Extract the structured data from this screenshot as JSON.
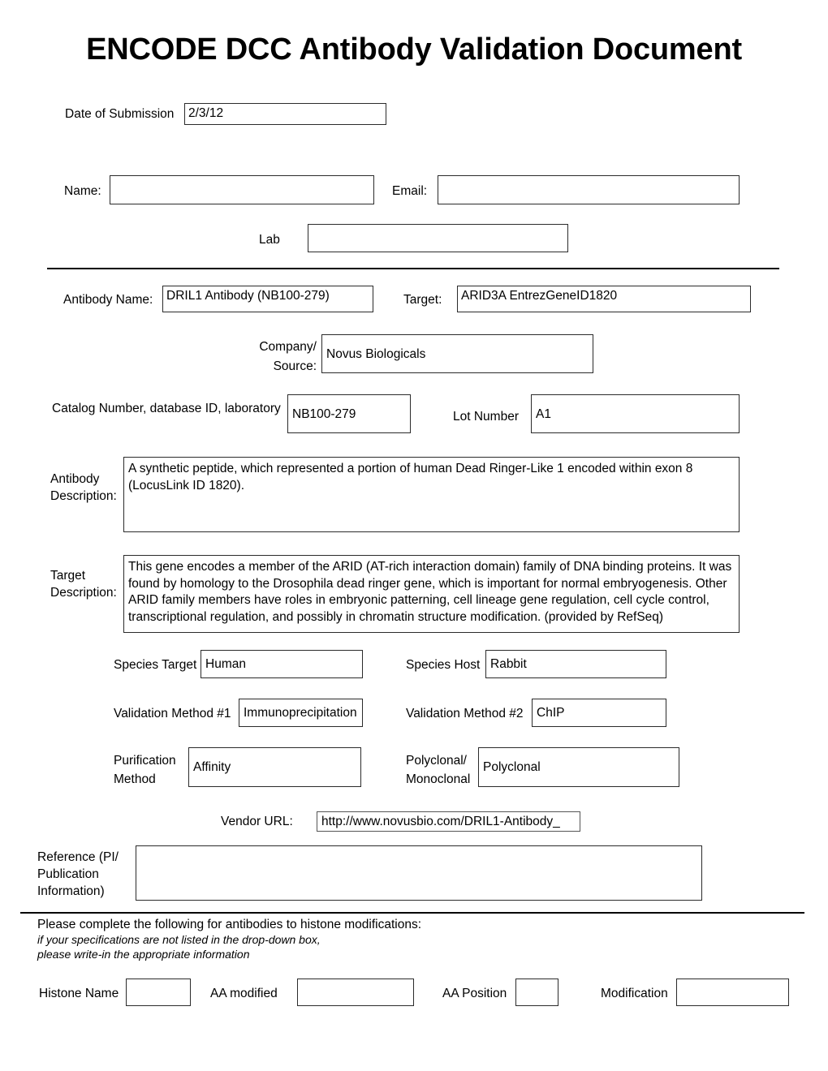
{
  "document": {
    "title": "ENCODE DCC Antibody Validation Document"
  },
  "submission": {
    "date_label": "Date of Submission",
    "date_value": "2/3/12"
  },
  "submitter": {
    "name_label": "Name:",
    "name_value": "",
    "email_label": "Email:",
    "email_value": "",
    "lab_label": "Lab",
    "lab_value": ""
  },
  "antibody": {
    "name_label": "Antibody Name:",
    "name_value": "DRIL1 Antibody (NB100-279)",
    "target_label": "Target:",
    "target_value": "ARID3A EntrezGeneID1820",
    "company_label": "Company/\nSource:",
    "company_label_line1": "Company/",
    "company_label_line2": "Source:",
    "company_value": "Novus Biologicals",
    "catalog_label": "Catalog Number, database ID, laboratory",
    "catalog_value": "NB100-279",
    "lot_label": "Lot Number",
    "lot_value": "A1",
    "description_label_line1": "Antibody",
    "description_label_line2": "Description:",
    "description_value": "A synthetic peptide, which represented a portion of human Dead Ringer-Like 1 encoded within exon 8 (LocusLink ID 1820).",
    "target_description_label_line1": "Target",
    "target_description_label_line2": "Description:",
    "target_description_value": "This gene encodes a member of the ARID (AT-rich interaction domain) family of DNA binding proteins. It was found by homology to the Drosophila dead ringer gene, which is important for normal embryogenesis. Other ARID family members have roles in embryonic patterning, cell lineage gene regulation, cell cycle control, transcriptional regulation, and possibly in chromatin structure modification. (provided by RefSeq)"
  },
  "properties": {
    "species_target_label": "Species Target",
    "species_target_value": "Human",
    "species_host_label": "Species Host",
    "species_host_value": "Rabbit",
    "validation1_label": "Validation Method #1",
    "validation1_value": "Immunoprecipitation",
    "validation2_label": "Validation Method #2",
    "validation2_value": "ChIP",
    "purification_label_line1": "Purification",
    "purification_label_line2": "Method",
    "purification_value": "Affinity",
    "clonality_label_line1": "Polyclonal/",
    "clonality_label_line2": "Monoclonal",
    "clonality_value": "Polyclonal",
    "vendor_url_label": "Vendor URL:",
    "vendor_url_value": "http://www.novusbio.com/DRIL1-Antibody_"
  },
  "reference": {
    "label_line1": "Reference (PI/",
    "label_line2": "Publication",
    "label_line3": "Information)",
    "value": ""
  },
  "histone": {
    "instruction": "Please complete the following for antibodies to histone modifications:",
    "note_line1": "if your specifications are not listed in the drop-down box,",
    "note_line2": "please write-in the appropriate information",
    "histone_name_label": "Histone Name",
    "histone_name_value": "",
    "aa_modified_label": "AA modified",
    "aa_modified_value": "",
    "aa_position_label": "AA Position",
    "aa_position_value": "",
    "modification_label": "Modification",
    "modification_value": ""
  }
}
